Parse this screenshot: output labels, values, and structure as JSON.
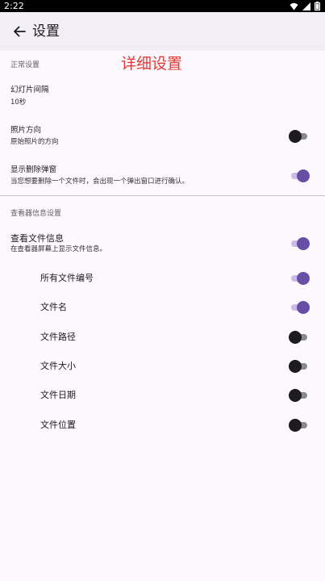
{
  "status_bar": {
    "time": "2:22"
  },
  "app_bar": {
    "title": "设置"
  },
  "overlay_title": "详细设置",
  "section_general": {
    "header": "正常设置",
    "slideshow": {
      "title": "幻灯片间隔",
      "summary": "10秒"
    },
    "orientation": {
      "title": "照片方向",
      "summary": "原始照片的方向",
      "enabled": false
    },
    "delete_dialog": {
      "title": "显示删除弹窗",
      "summary": "当您想要删除一个文件时，会出现一个弹出窗口进行确认。",
      "enabled": true
    }
  },
  "section_viewer": {
    "header": "查看器信息设置",
    "file_info": {
      "title": "查看文件信息",
      "summary": "在查看器屏幕上显示文件信息。",
      "enabled": true
    },
    "items": [
      {
        "label": "所有文件编号",
        "enabled": true
      },
      {
        "label": "文件名",
        "enabled": true
      },
      {
        "label": "文件路径",
        "enabled": false
      },
      {
        "label": "文件大小",
        "enabled": false
      },
      {
        "label": "文件日期",
        "enabled": false
      },
      {
        "label": "文件位置",
        "enabled": false
      }
    ]
  },
  "colors": {
    "accent": "#6750a4",
    "app_bar": "#f2eef7",
    "overlay_text": "#e53935"
  }
}
